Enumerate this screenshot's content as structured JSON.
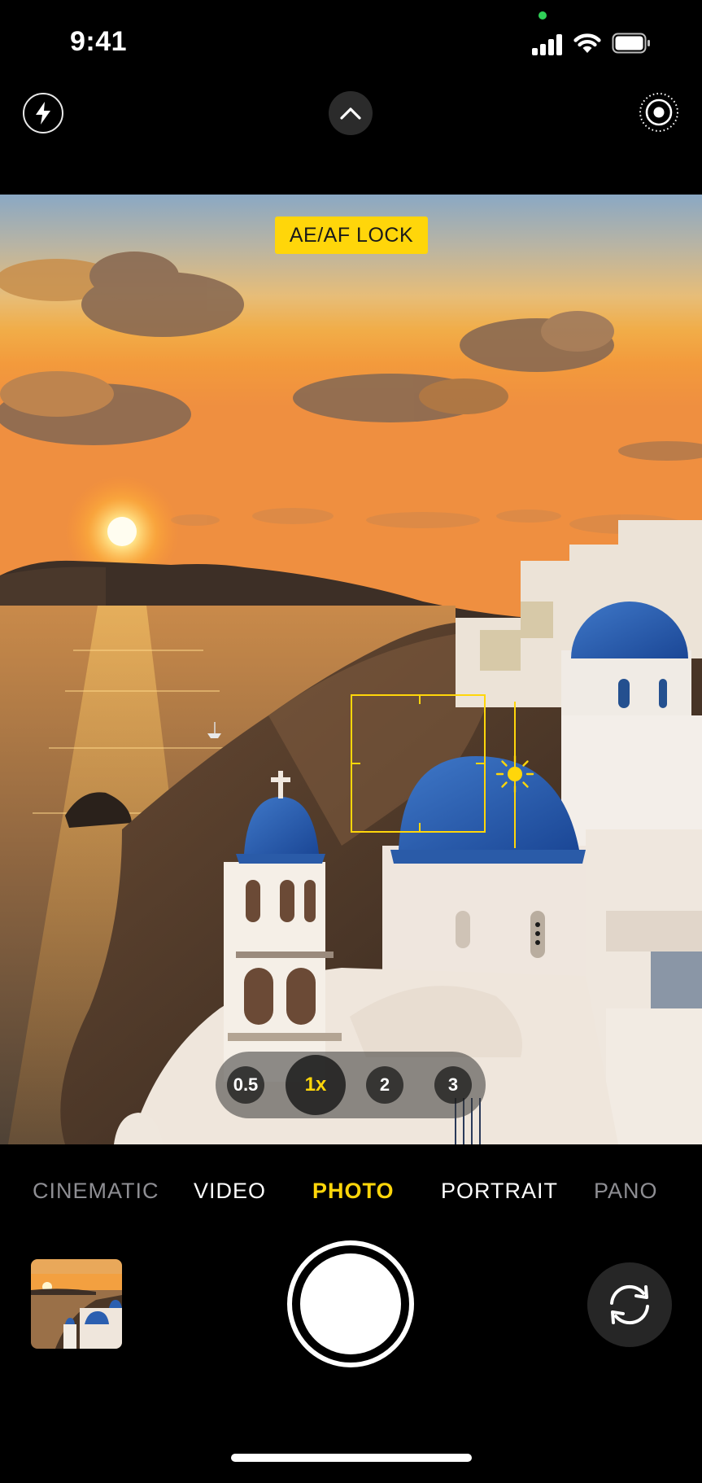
{
  "status_bar": {
    "time": "9:41",
    "mic_indicator_color": "#30d158"
  },
  "top_controls": {
    "flash_icon": "bolt-icon",
    "expand_icon": "chevron-up-icon",
    "live_photo_icon": "live-photo-icon"
  },
  "viewfinder": {
    "lock_badge": "AE/AF LOCK",
    "accent_color": "#ffd60a"
  },
  "zoom": {
    "options": [
      "0.5",
      "1x",
      "2",
      "3"
    ],
    "selected": "1x"
  },
  "modes": {
    "items": [
      "CINEMATIC",
      "VIDEO",
      "PHOTO",
      "PORTRAIT",
      "PANO"
    ],
    "selected": "PHOTO"
  },
  "bottom_controls": {
    "shutter_icon": "shutter-button",
    "flip_icon": "camera-flip-icon"
  }
}
